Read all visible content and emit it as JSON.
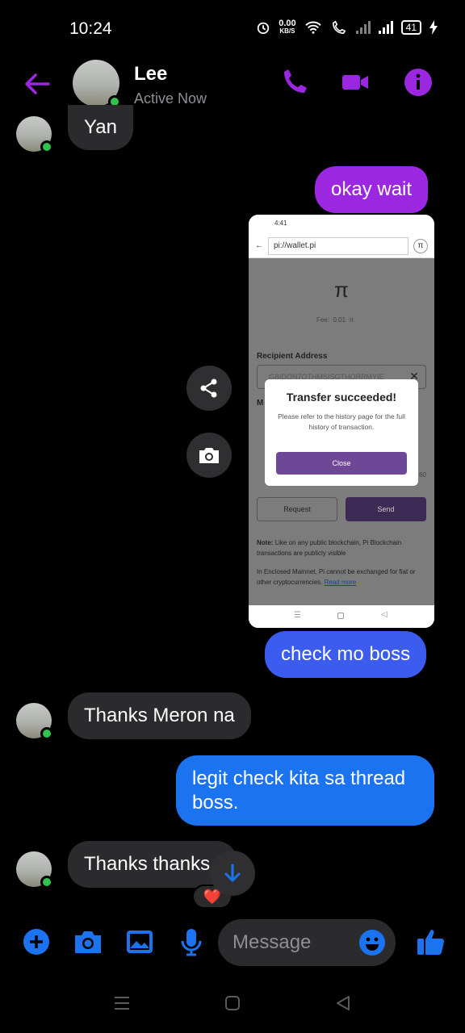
{
  "status_bar": {
    "time": "10:24",
    "speed_value": "0.00",
    "speed_unit": "KB/S",
    "battery": "41"
  },
  "header": {
    "contact_name": "Lee",
    "status": "Active Now"
  },
  "messages": [
    {
      "text": "Yan"
    },
    {
      "text": "okay wait"
    },
    {
      "text": "check mo boss"
    },
    {
      "text": "Thanks Meron na"
    },
    {
      "text": "legit check kita sa thread boss."
    },
    {
      "text": "Thanks thanks"
    }
  ],
  "screenshot": {
    "status_time": "4:41",
    "url": "pi://wallet.pi",
    "pi_symbol": "π",
    "fee_label": "Fee:",
    "fee_value": "0.01",
    "fee_unit": "π",
    "recipient_label": "Recipient Address",
    "recipient_value": "GBIDON7OTHMSISGTHORRMYIE",
    "memo_label": "M",
    "balance_fragment": "60",
    "modal_title": "Transfer succeeded!",
    "modal_text": "Please refer to the history page for the full history of transaction.",
    "modal_button": "Close",
    "request_button": "Request",
    "send_button": "Send",
    "note_label": "Note:",
    "note_text": "Like on any public blockchain, Pi Blockchain transactions are publicly visible",
    "mainnet_text": "In Enclosed Mainnet, Pi cannot be exchanged for fiat or other cryptocurrencies.",
    "read_more": "Read more"
  },
  "reaction": "❤️",
  "composer": {
    "placeholder": "Message"
  },
  "colors": {
    "accent_purple": "#9b27e0",
    "messenger_blue": "#1b73f0",
    "online_green": "#31c24d"
  }
}
